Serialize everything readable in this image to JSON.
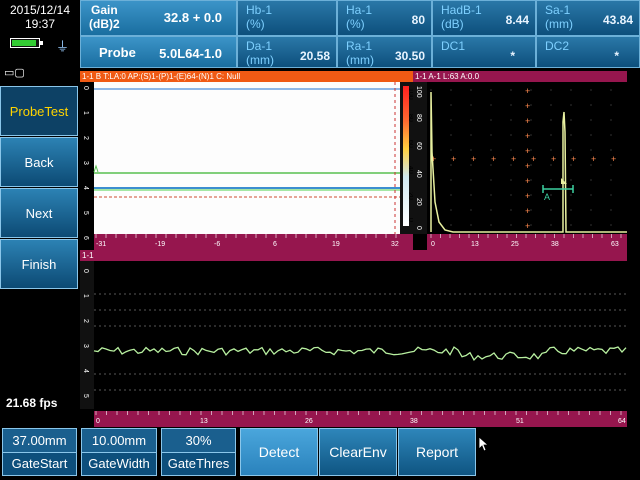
{
  "header": {
    "date": "2015/12/14",
    "time": "19:37",
    "params": [
      {
        "label": "Gain\n(dB)2",
        "value": "32.8 + 0.0"
      },
      {
        "label": "Hb-1\n(%)",
        "value": ""
      },
      {
        "label": "Ha-1\n(%)",
        "value": "80"
      },
      {
        "label": "HadB-1\n(dB)",
        "value": "8.44"
      },
      {
        "label": "Sa-1\n(mm)",
        "value": "43.84"
      },
      {
        "label": "Probe",
        "value": "5.0L64-1.0"
      },
      {
        "label": "Da-1\n(mm)",
        "value": "20.58"
      },
      {
        "label": "Ra-1\n(mm)",
        "value": "30.50"
      },
      {
        "label": "DC1",
        "value": "*"
      },
      {
        "label": "DC2",
        "value": "*"
      }
    ]
  },
  "menu": {
    "items": [
      "ProbeTest",
      "Back",
      "Next",
      "Finish"
    ],
    "fps": "21.68 fps"
  },
  "panels": {
    "bscan_title": "1-1  B  T:LA:0 AP:(S)1-(P)1-(E)64-(N)1 C: Null",
    "ascan_title": "1-1  A-1  L:63  A:0.0",
    "cscan_title": "1-1",
    "bscan_yticks": [
      "0",
      "1",
      "2",
      "3",
      "4",
      "5",
      "6"
    ],
    "bscan_xticks": [
      "-31",
      "-19",
      "-6",
      "6",
      "19",
      "32"
    ],
    "bscan_scale": [
      "100",
      "80",
      "60",
      "40",
      "20",
      "0"
    ],
    "ascan_xticks": [
      "0",
      "13",
      "25",
      "38",
      "63"
    ],
    "ascan_yticks": [
      "100",
      "80",
      "60",
      "40",
      "20",
      "0"
    ],
    "ascan_marker": "A",
    "cscan_xticks": [
      "0",
      "13",
      "26",
      "38",
      "51",
      "64"
    ],
    "cscan_yticks": [
      "0",
      "1",
      "2",
      "3",
      "4",
      "5"
    ]
  },
  "bottom": {
    "gates": [
      {
        "value": "37.00mm",
        "label": "GateStart"
      },
      {
        "value": "10.00mm",
        "label": "GateWidth"
      },
      {
        "value": "30%",
        "label": "GateThres"
      }
    ],
    "actions": [
      "Detect",
      "ClearEnv",
      "Report"
    ]
  },
  "colors": {
    "bscan_header": "#f05a14",
    "ascan_header": "#96164e",
    "trace": "#b8f0a0",
    "marker": "#ff8a50",
    "gate": "#3cd0a0"
  }
}
